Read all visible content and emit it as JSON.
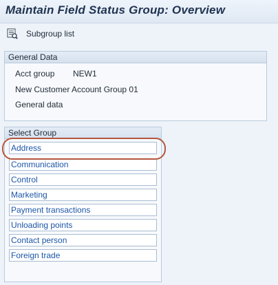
{
  "window": {
    "title": "Maintain Field Status Group: Overview"
  },
  "toolbar": {
    "subgroup_list_label": "Subgroup list",
    "subgroup_list_icon": "list-detail-icon"
  },
  "general_data": {
    "header": "General Data",
    "acct_group_label": "Acct group",
    "acct_group_value": "NEW1",
    "description": "New Customer Account Group 01",
    "general_data_text": "General data"
  },
  "select_group": {
    "header": "Select Group",
    "items": [
      {
        "label": "Address"
      },
      {
        "label": "Communication"
      },
      {
        "label": "Control"
      },
      {
        "label": "Marketing"
      },
      {
        "label": "Payment transactions"
      },
      {
        "label": "Unloading points"
      },
      {
        "label": "Contact person"
      },
      {
        "label": "Foreign trade"
      }
    ],
    "highlighted": "Address"
  },
  "colors": {
    "link": "#1b55a7",
    "highlight_oval": "#b5553b",
    "title": "#1f3350"
  }
}
